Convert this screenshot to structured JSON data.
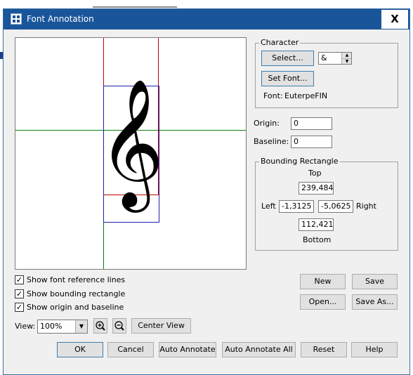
{
  "window": {
    "title": "Font Annotation",
    "close_glyph": "X"
  },
  "canvas": {
    "glyph": "𝄞"
  },
  "character": {
    "group_label": "Character",
    "select_label": "Select...",
    "char_value": "&",
    "set_font_label": "Set Font...",
    "font_label": "Font:",
    "font_name": "EuterpeFIN"
  },
  "origin": {
    "label": "Origin:",
    "value": "0"
  },
  "baseline": {
    "label": "Baseline:",
    "value": "0"
  },
  "bounding": {
    "group_label": "Bounding Rectangle",
    "top_label": "Top",
    "top_value": "239,484375",
    "left_label": "Left",
    "left_value": "-1,3125",
    "right_value": "-5,0625",
    "right_label": "Right",
    "bottom_value": "112,421875",
    "bottom_label": "Bottom"
  },
  "options": {
    "show_reference_lines": {
      "label": "Show font reference lines",
      "checked": true
    },
    "show_bounding_rect": {
      "label": "Show bounding rectangle",
      "checked": true
    },
    "show_origin_baseline": {
      "label": "Show origin and baseline",
      "checked": true
    }
  },
  "view": {
    "label": "View:",
    "zoom_value": "100%",
    "center_label": "Center View"
  },
  "file_buttons": {
    "new": "New",
    "save": "Save",
    "open": "Open...",
    "save_as": "Save As..."
  },
  "bottom_buttons": {
    "ok": "OK",
    "cancel": "Cancel",
    "auto_annotate": "Auto Annotate",
    "auto_annotate_all": "Auto Annotate All",
    "reset": "Reset",
    "help": "Help"
  },
  "colors": {
    "titlebar": "#19559a",
    "reference_line": "#0a7f0a",
    "red_rect": "#c00000",
    "blue_rect": "#2020b0",
    "dialog_bg": "#f0f0f0"
  }
}
